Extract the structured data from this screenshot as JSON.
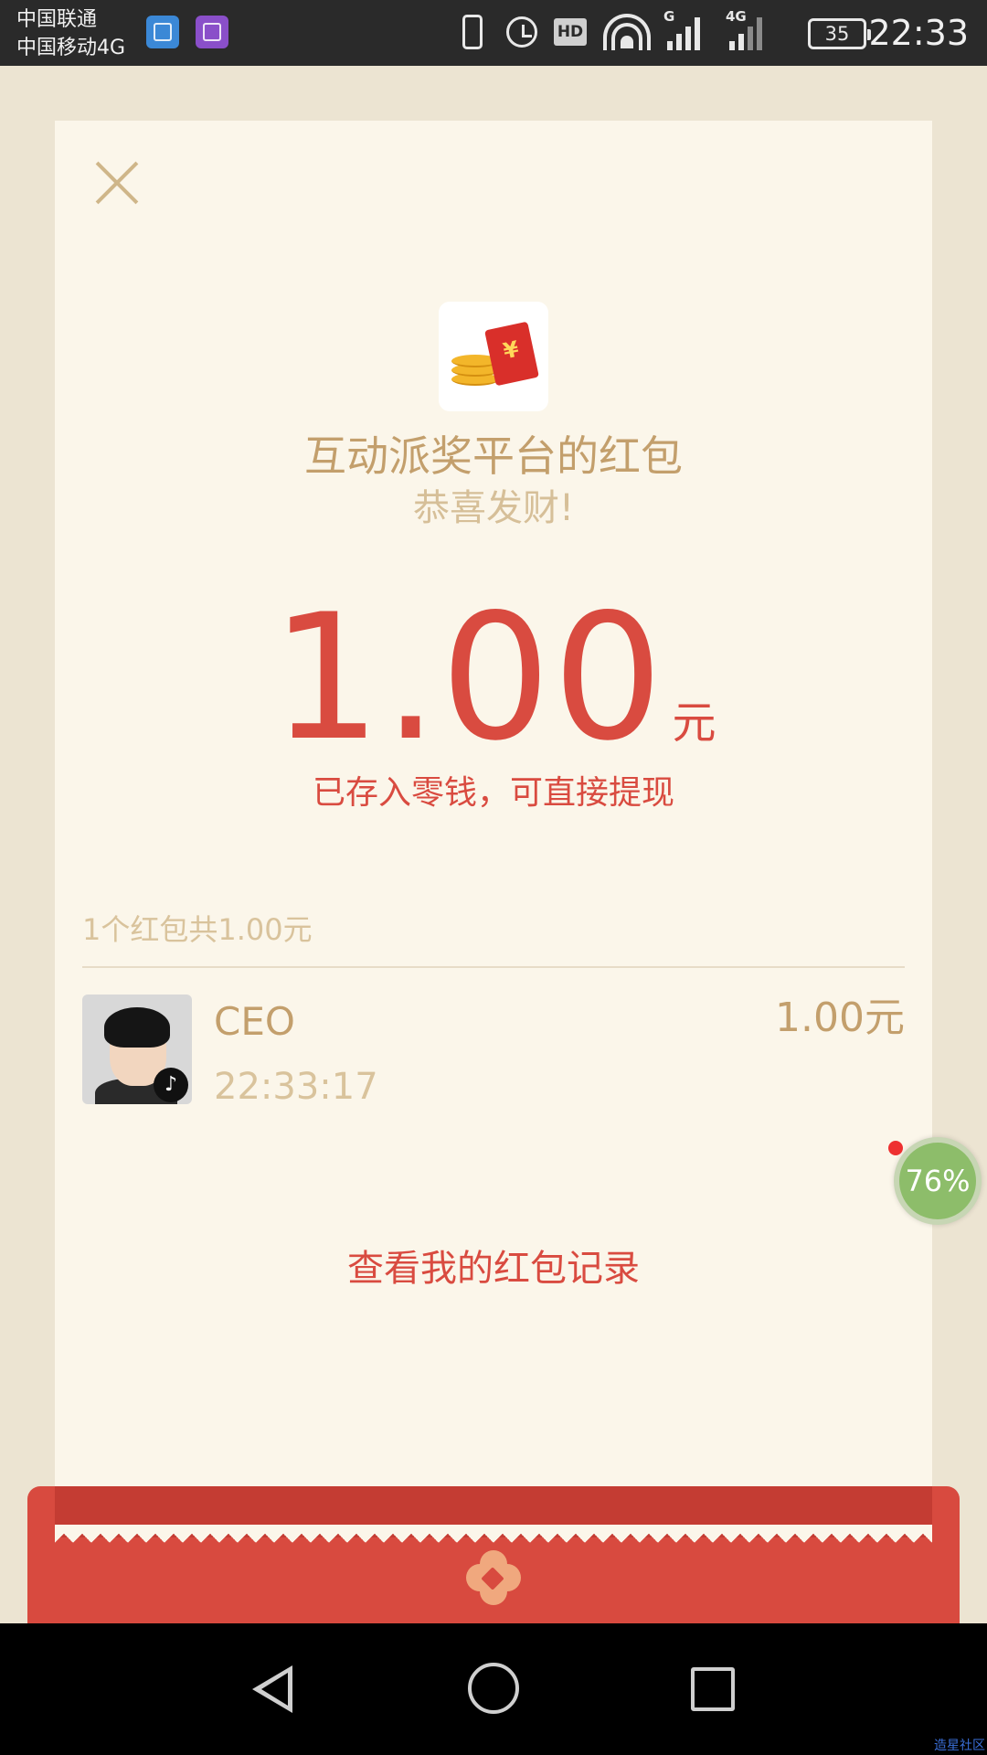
{
  "status_bar": {
    "carrier_1": "中国联通",
    "carrier_2": "中国移动4G",
    "hd_label": "HD",
    "signal_1_label": "G",
    "signal_2_label": "4G",
    "battery_level": "35",
    "time": "22:33"
  },
  "red_packet": {
    "sender_title": "互动派奖平台的红包",
    "greeting": "恭喜发财!",
    "amount": "1.00",
    "unit": "元",
    "saved_note": "已存入零钱，可直接提现",
    "summary": "1个红包共1.00元",
    "receiver": {
      "name": "CEO",
      "time": "22:33:17",
      "amount": "1.00元"
    },
    "records_link": "查看我的红包记录"
  },
  "float_widget": {
    "label": "76%"
  },
  "watermark": "造星社区",
  "colors": {
    "accent_red": "#d94b40",
    "gold_text": "#c39f6c",
    "card_bg": "#fbf6ea"
  }
}
